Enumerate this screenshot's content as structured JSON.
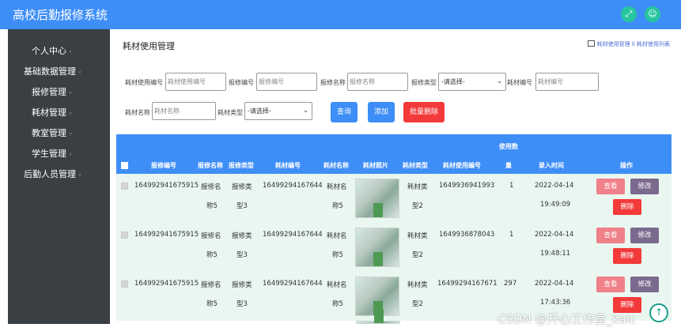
{
  "header": {
    "title": "高校后勤报修系统",
    "left_icon": "fullscreen-icon",
    "right_icon": "user-icon",
    "accent": "#3e8ef7"
  },
  "sidebar": {
    "items": [
      {
        "label": "个人中心"
      },
      {
        "label": "基础数据管理"
      },
      {
        "label": "报修管理"
      },
      {
        "label": "耗材管理"
      },
      {
        "label": "教室管理"
      },
      {
        "label": "学生管理"
      },
      {
        "label": "后勤人员管理"
      }
    ]
  },
  "page": {
    "title": "耗材使用管理",
    "breadcrumb": "耗材使用管理 ll 耗材使用列表",
    "breadcrumb_sep": "ll"
  },
  "filters": {
    "usage_no_label": "耗材使用编号",
    "usage_no_placeholder": "耗材使用编号",
    "repair_no_label": "报修编号",
    "repair_no_placeholder": "报修编号",
    "repair_name_label": "报修名称",
    "repair_name_placeholder": "报修名称",
    "repair_type_label": "报修类型",
    "repair_type_value": "-请选择-",
    "material_no_label": "耗材编号",
    "material_no_placeholder": "耗材编号",
    "material_name_label": "耗材名称",
    "material_name_placeholder": "耗材名称",
    "material_type_label": "耗材类型",
    "material_type_value": "-请选择-",
    "query_label": "查询",
    "add_label": "添加",
    "batch_delete_label": "批量删除"
  },
  "table": {
    "headers": [
      "报修编号",
      "报修名称",
      "报修类型",
      "耗材编号",
      "耗材名称",
      "耗材照片",
      "耗材类型",
      "耗材使用编号",
      "使用数量",
      "录入时间",
      "操作"
    ],
    "usage_top": "使用数",
    "usage_bottom": "量",
    "rows": [
      {
        "repair_no": "164992941675915",
        "repair_name_1": "报修名",
        "repair_name_2": "称5",
        "repair_type_1": "报修类",
        "repair_type_2": "型3",
        "material_no": "16499294167644",
        "material_name_1": "耗材名",
        "material_name_2": "称5",
        "material_type_1": "耗材类",
        "material_type_2": "型2",
        "usage_no": "1649936941993",
        "qty": "1",
        "date": "2022-04-14",
        "time": "19:49:09"
      },
      {
        "repair_no": "164992941675915",
        "repair_name_1": "报修名",
        "repair_name_2": "称5",
        "repair_type_1": "报修类",
        "repair_type_2": "型3",
        "material_no": "16499294167644",
        "material_name_1": "耗材名",
        "material_name_2": "称5",
        "material_type_1": "耗材类",
        "material_type_2": "型2",
        "usage_no": "1649936878043",
        "qty": "1",
        "date": "2022-04-14",
        "time": "19:48:11"
      },
      {
        "repair_no": "164992941675915",
        "repair_name_1": "报修名",
        "repair_name_2": "称5",
        "repair_type_1": "报修类",
        "repair_type_2": "型3",
        "material_no": "16499294167644",
        "material_name_1": "耗材名",
        "material_name_2": "称5",
        "material_type_1": "耗材类",
        "material_type_2": "型2",
        "usage_no": "16499294167671",
        "qty": "297",
        "date": "2022-04-14",
        "time": "17:43:36"
      }
    ],
    "view_label": "查看",
    "edit_label": "修改",
    "delete_label": "删除"
  },
  "watermark": "CSDN @开心工作室_kaic",
  "colors": {
    "view": "#f0808a",
    "edit": "#7b6a8e",
    "delete": "#f23a3a",
    "query": "#3e8ef7",
    "add": "#3e8ef7",
    "batch_delete": "#f23a3a",
    "row_bg": "#e9f7f0"
  }
}
